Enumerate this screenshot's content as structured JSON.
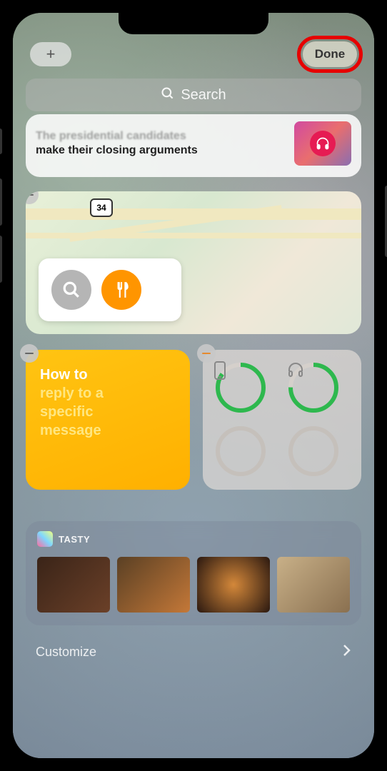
{
  "topbar": {
    "add_label": "+",
    "done_label": "Done"
  },
  "search": {
    "placeholder": "Search"
  },
  "news": {
    "line1": "The presidential candidates",
    "line2": "make their closing arguments"
  },
  "maps": {
    "route": "34"
  },
  "notes": {
    "l1": "How to",
    "l2": "reply to a",
    "l3": "specific",
    "l4": "message"
  },
  "tasty": {
    "label": "TASTY"
  },
  "footer": {
    "customize": "Customize"
  }
}
